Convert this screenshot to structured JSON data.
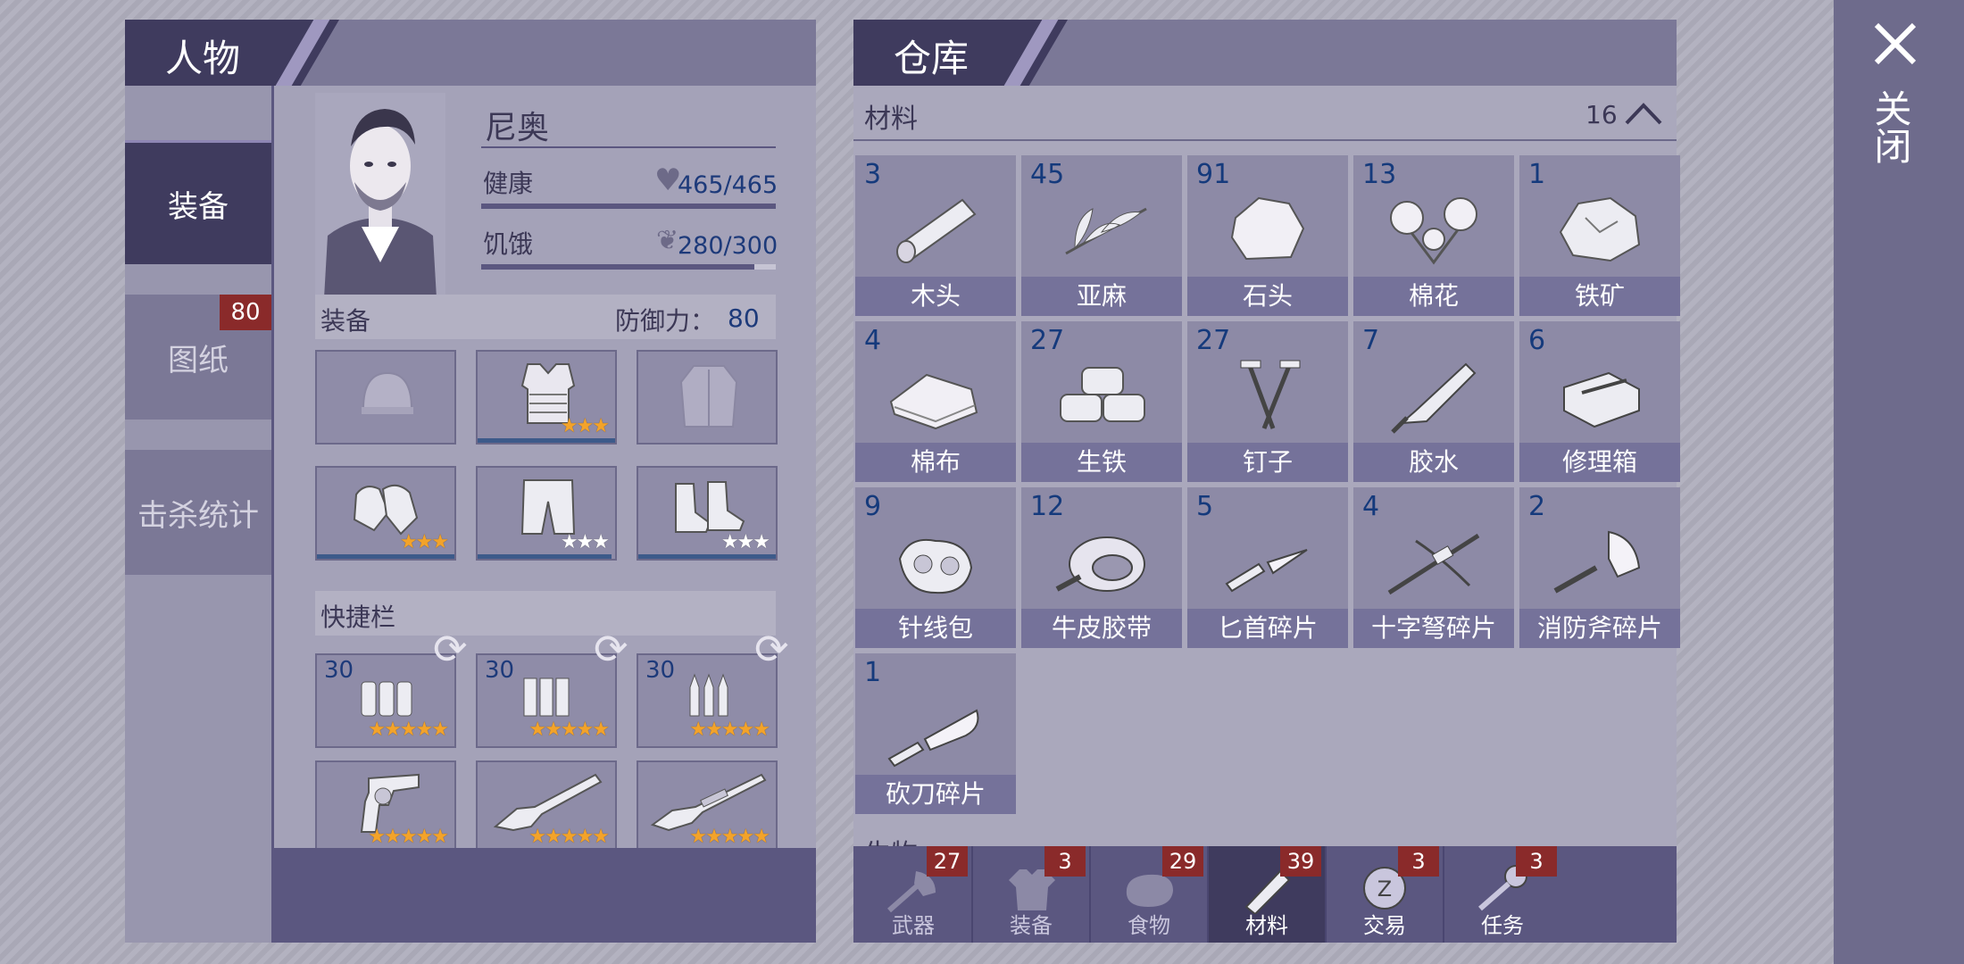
{
  "character_panel": {
    "title": "人物",
    "side_tabs": [
      {
        "label": "装备",
        "active": true
      },
      {
        "label": "图纸",
        "badge": "80"
      },
      {
        "label": "击杀统计"
      }
    ],
    "name": "尼奥",
    "health": {
      "label": "健康",
      "value": "465/465",
      "fraction": 1.0
    },
    "hunger": {
      "label": "饥饿",
      "value": "280/300",
      "fraction": 0.933
    },
    "equipment": {
      "label": "装备",
      "defense_label": "防御力：",
      "defense_value": "80"
    },
    "equip_slots": [
      {
        "name": "helmet",
        "stars": 0
      },
      {
        "name": "armor-vest",
        "stars": 3,
        "star_color": "gold"
      },
      {
        "name": "jacket",
        "stars": 0
      },
      {
        "name": "gloves",
        "stars": 3,
        "star_color": "gold"
      },
      {
        "name": "pants",
        "stars": 3,
        "star_color": "white"
      },
      {
        "name": "boots",
        "stars": 3,
        "star_color": "white"
      }
    ],
    "quickbar": {
      "label": "快捷栏"
    },
    "ammo_slots": [
      {
        "count": "30",
        "stars": 5
      },
      {
        "count": "30",
        "stars": 5
      },
      {
        "count": "30",
        "stars": 5
      }
    ],
    "weapon_slots": [
      {
        "name": "revolver",
        "stars": 5
      },
      {
        "name": "shotgun",
        "stars": 5
      },
      {
        "name": "rifle",
        "stars": 5
      }
    ]
  },
  "warehouse_panel": {
    "title": "仓库",
    "section": {
      "label": "材料",
      "count": "16"
    },
    "next_section_label": "生物",
    "items": [
      {
        "count": "3",
        "label": "木头",
        "icon": "log-icon"
      },
      {
        "count": "45",
        "label": "亚麻",
        "icon": "flax-icon"
      },
      {
        "count": "91",
        "label": "石头",
        "icon": "stone-icon"
      },
      {
        "count": "13",
        "label": "棉花",
        "icon": "cotton-icon"
      },
      {
        "count": "1",
        "label": "铁矿",
        "icon": "iron-ore-icon"
      },
      {
        "count": "4",
        "label": "棉布",
        "icon": "cloth-icon"
      },
      {
        "count": "27",
        "label": "生铁",
        "icon": "pig-iron-icon"
      },
      {
        "count": "27",
        "label": "钉子",
        "icon": "nails-icon"
      },
      {
        "count": "7",
        "label": "胶水",
        "icon": "glue-icon"
      },
      {
        "count": "6",
        "label": "修理箱",
        "icon": "repair-kit-icon"
      },
      {
        "count": "9",
        "label": "针线包",
        "icon": "sewing-kit-icon"
      },
      {
        "count": "12",
        "label": "牛皮胶带",
        "icon": "tape-icon"
      },
      {
        "count": "5",
        "label": "匕首碎片",
        "icon": "dagger-fragment-icon"
      },
      {
        "count": "4",
        "label": "十字弩碎片",
        "icon": "crossbow-fragment-icon"
      },
      {
        "count": "2",
        "label": "消防斧碎片",
        "icon": "axe-fragment-icon"
      },
      {
        "count": "1",
        "label": "砍刀碎片",
        "icon": "machete-fragment-icon"
      }
    ],
    "bottom_tabs": [
      {
        "label": "武器",
        "badge": "27",
        "icon": "axe-icon"
      },
      {
        "label": "装备",
        "badge": "3",
        "icon": "shirt-icon"
      },
      {
        "label": "食物",
        "badge": "29",
        "icon": "meat-icon"
      },
      {
        "label": "材料",
        "badge": "39",
        "icon": "log-icon",
        "active": true
      },
      {
        "label": "交易",
        "badge": "3",
        "icon": "coin-icon"
      },
      {
        "label": "任务",
        "badge": "3",
        "icon": "key-icon"
      }
    ]
  },
  "close": {
    "label": "关闭"
  },
  "colors": {
    "badge": "#8a2a2a",
    "accent_dark": "#3f3b5e",
    "count_blue": "#153a7c",
    "star_gold": "#f3a32a"
  }
}
